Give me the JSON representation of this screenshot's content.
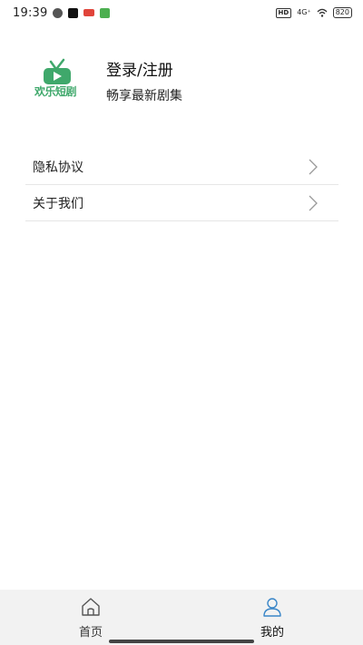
{
  "status_bar": {
    "time": "19:39",
    "hd": "HD",
    "network": "4G⁺",
    "battery": "820"
  },
  "profile": {
    "logo_text": "欢乐短剧",
    "title": "登录/注册",
    "subtitle": "畅享最新剧集"
  },
  "menu": {
    "items": [
      {
        "label": "隐私协议"
      },
      {
        "label": "关于我们"
      }
    ]
  },
  "bottom_nav": {
    "tabs": [
      {
        "label": "首页",
        "icon": "home-icon"
      },
      {
        "label": "我的",
        "icon": "user-icon"
      }
    ]
  },
  "colors": {
    "brand_green": "#3fa86b",
    "active_tab": "#3a86c8",
    "nav_background": "#f2f2f2"
  }
}
